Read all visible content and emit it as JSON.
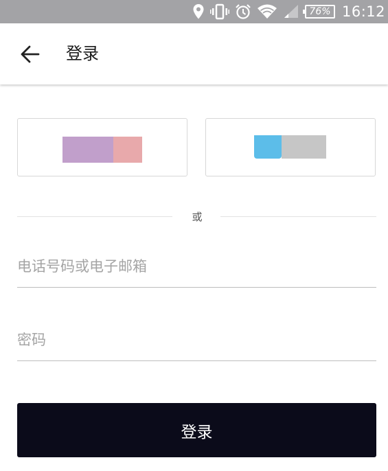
{
  "status_bar": {
    "battery": "76%",
    "time": "16:12",
    "icons": [
      "location-icon",
      "vibrate-icon",
      "alarm-icon",
      "wifi-icon",
      "cell-signal-icon",
      "battery-icon"
    ]
  },
  "header": {
    "title": "登录",
    "back_icon": "arrow-left-icon"
  },
  "social_logins": [
    {
      "name": "social-login-left",
      "colors": [
        "#c19fcb",
        "#e8a9ab"
      ]
    },
    {
      "name": "social-login-right",
      "colors": [
        "#5cbde9",
        "#c6c6c6"
      ]
    }
  ],
  "divider": {
    "text": "或"
  },
  "form": {
    "phone_placeholder": "电话号码或电子邮箱",
    "password_placeholder": "密码",
    "submit_label": "登录"
  },
  "colors": {
    "status_bar_bg": "#a3a3a6",
    "button_bg": "#0b0b1a",
    "input_border": "#bdbdbd"
  }
}
